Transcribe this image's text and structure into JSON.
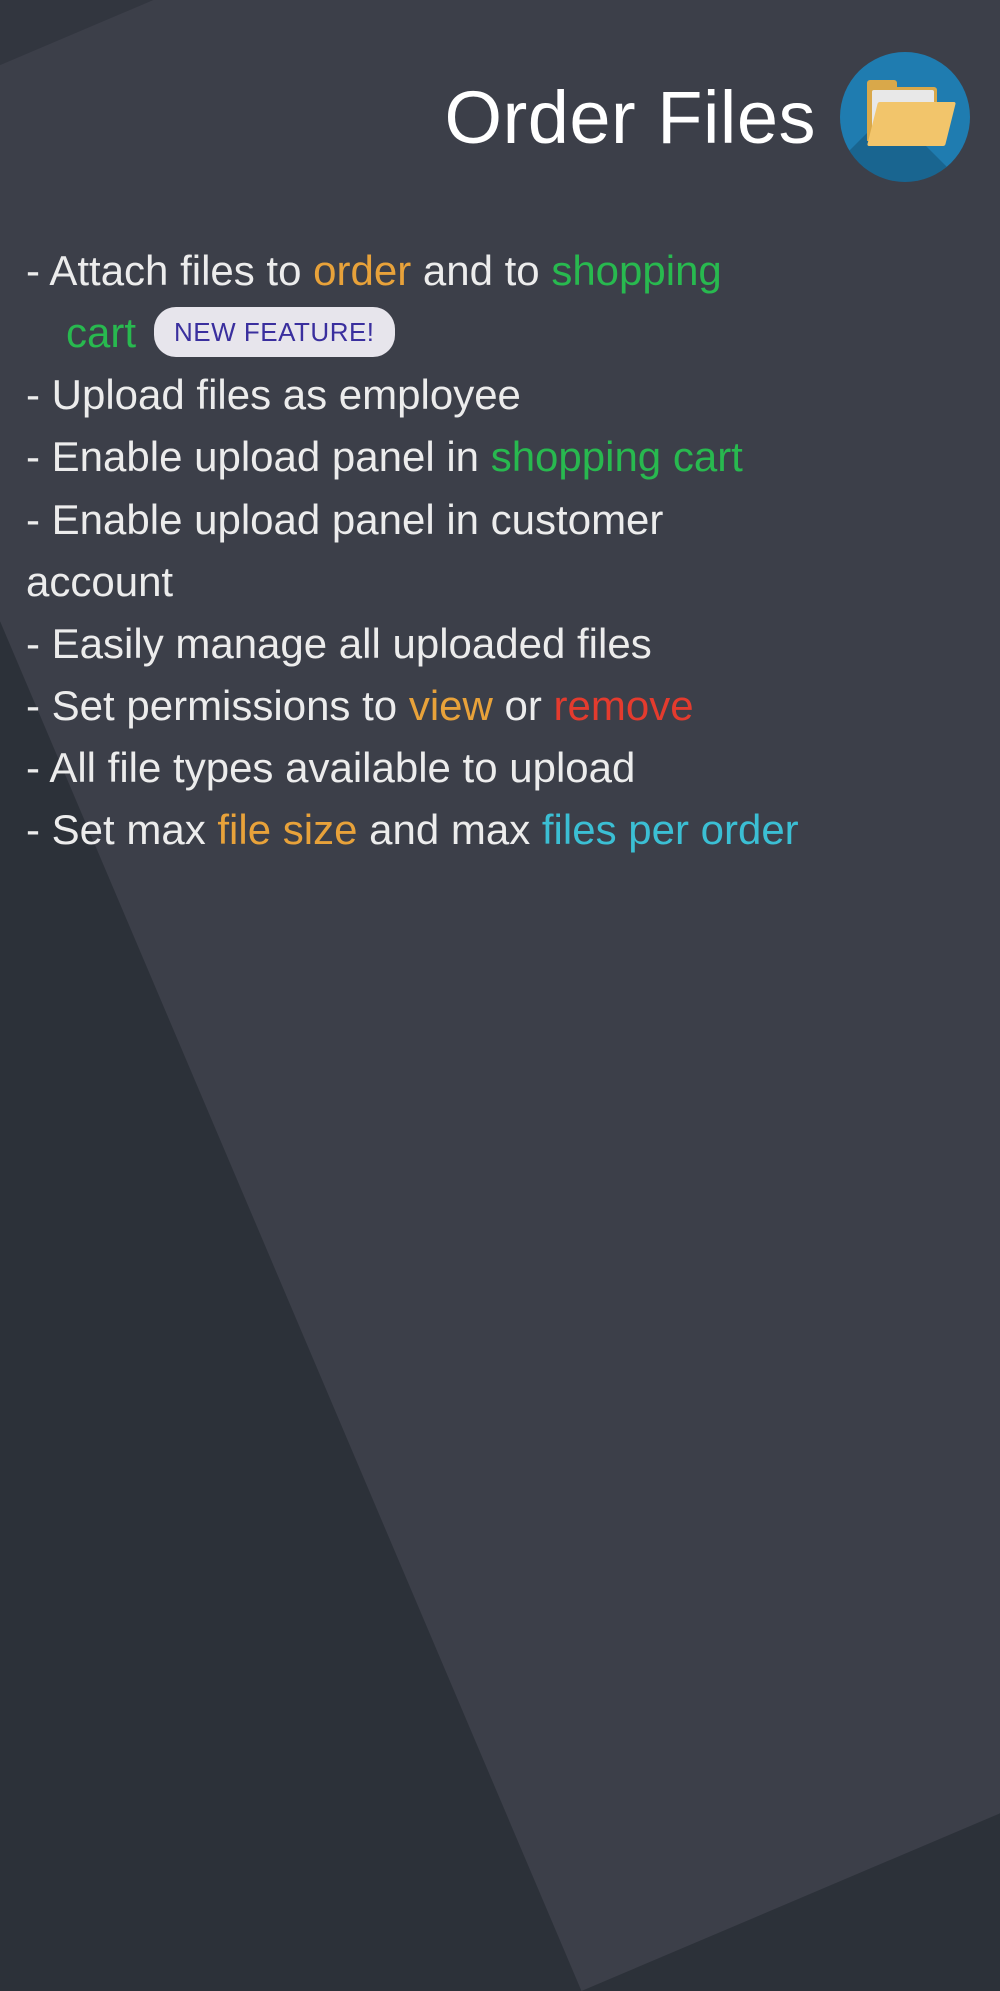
{
  "title": "Order Files",
  "badge": "NEW FEATURE!",
  "features": {
    "f1_pre": "- Attach files to ",
    "f1_order": "order",
    "f1_mid": " and to  ",
    "f1_shop": "shopping",
    "f1_cart": "cart",
    "f2": "- Upload files as employee",
    "f3_pre": "- Enable upload panel in ",
    "f3_cart": "shopping cart",
    "f4a": "- Enable upload panel in customer",
    "f4b": "account",
    "f5": "- Easily manage all uploaded files",
    "f6_pre": "- Set permissions to ",
    "f6_view": "view",
    "f6_mid": " or ",
    "f6_remove": "remove",
    "f7": "- All file types available to upload",
    "f8_pre": "- Set max ",
    "f8_size": "file size",
    "f8_mid": " and max ",
    "f8_per": "files per order"
  }
}
